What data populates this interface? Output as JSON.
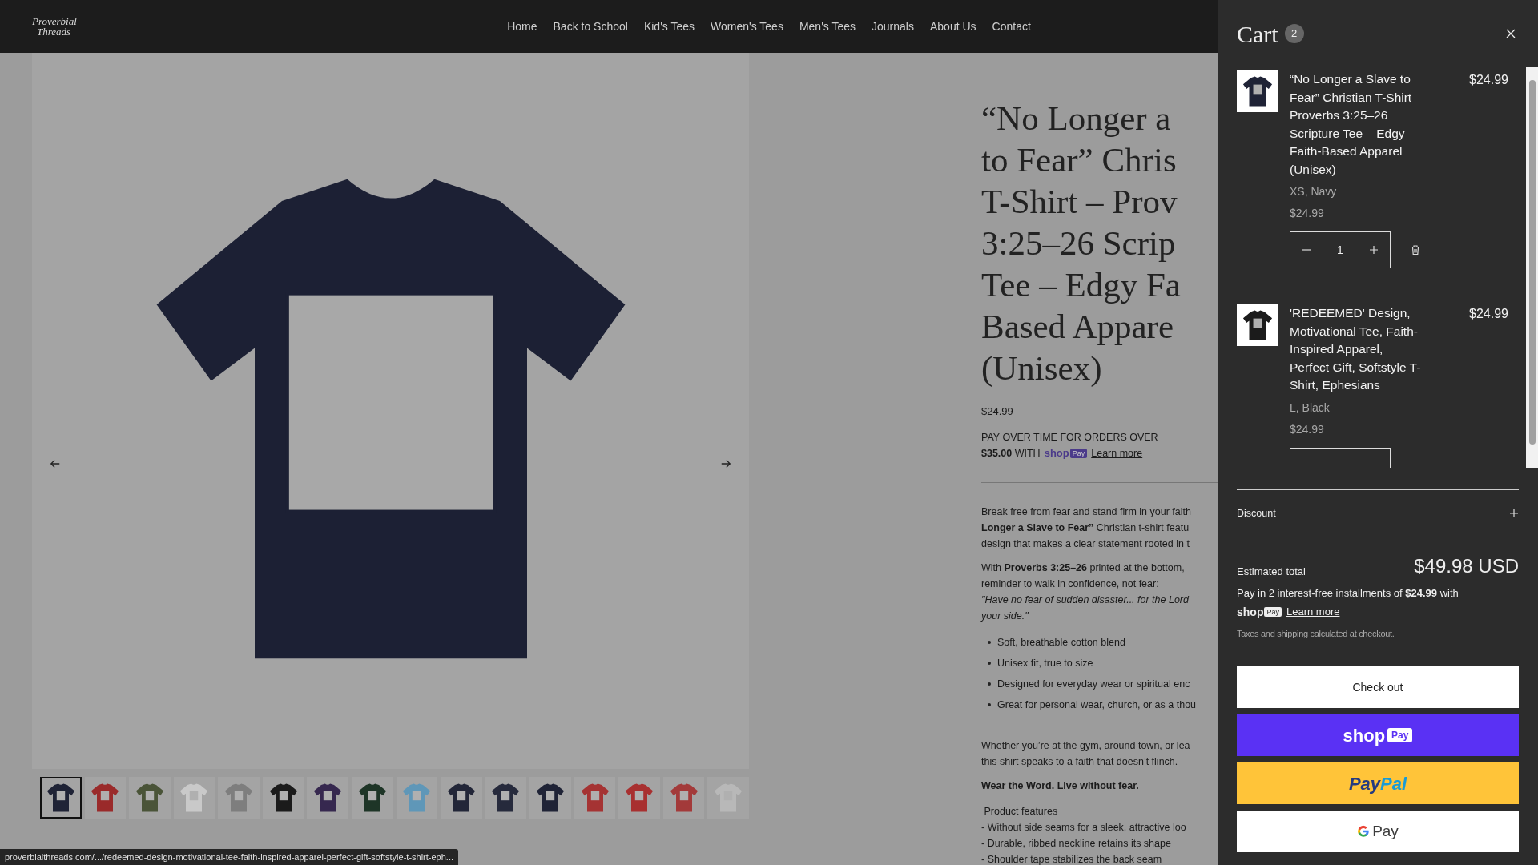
{
  "header": {
    "logo_lines": [
      "Proverbial",
      "Threads"
    ],
    "nav": [
      {
        "label": "Home"
      },
      {
        "label": "Back to School"
      },
      {
        "label": "Kid's Tees"
      },
      {
        "label": "Women's Tees"
      },
      {
        "label": "Men's Tees"
      },
      {
        "label": "Journals"
      },
      {
        "label": "About Us"
      },
      {
        "label": "Contact"
      }
    ]
  },
  "gallery": {
    "thumbnails": [
      {
        "selected": true,
        "color": "#1f2336"
      },
      {
        "selected": false,
        "color": "#9a2a2a"
      },
      {
        "selected": false,
        "color": "#4a5438"
      },
      {
        "selected": false,
        "color": "#c9c9c9"
      },
      {
        "selected": false,
        "color": "#7e7e7e"
      },
      {
        "selected": false,
        "color": "#1b1b1b"
      },
      {
        "selected": false,
        "color": "#36284f"
      },
      {
        "selected": false,
        "color": "#1e3527"
      },
      {
        "selected": false,
        "color": "#5f97b8"
      },
      {
        "selected": false,
        "color": "#222638"
      },
      {
        "selected": false,
        "color": "#262a3c"
      },
      {
        "selected": false,
        "color": "#1f2336"
      },
      {
        "selected": false,
        "color": "#a53333"
      },
      {
        "selected": false,
        "color": "#a83030"
      },
      {
        "selected": false,
        "color": "#a33a3a"
      },
      {
        "selected": false,
        "color": "#b8b8b8"
      }
    ]
  },
  "product": {
    "title_lines": [
      "“No Longer a",
      "to Fear” Chris",
      "T-Shirt – Prov",
      "3:25–26 Scrip",
      "Tee – Edgy Fa",
      "Based Appare",
      "(Unisex)"
    ],
    "price": "$24.99",
    "pay_over_time": {
      "line_1": "PAY OVER TIME FOR ORDERS OVER",
      "line_2": "**$35.00** WITH",
      "brand": "shop",
      "brand_badge": "Pay",
      "link": "Learn more"
    },
    "description": [
      {
        "kind": "paragraph",
        "lines": [
          "Break free from fear and stand firm in your faith",
          "**Longer a Slave to Fear”** Christian t-shirt featu",
          "design that makes a clear statement rooted in t"
        ]
      },
      {
        "kind": "paragraph",
        "lines": [
          "With **Proverbs 3:25–26** printed at the bottom,",
          "reminder to walk in confidence, not fear:",
          "*\"Have no fear of sudden disaster... for the Lord*",
          "*your side.\"*"
        ]
      },
      {
        "kind": "bullets",
        "lines": [
          "Soft, breathable cotton blend",
          "Unisex fit, true to size",
          "Designed for everyday wear or spiritual enc",
          "Great for personal wear, church, or as a thou"
        ]
      },
      {
        "kind": "paragraph",
        "lines": [
          "Whether you’re at the gym, around town, or lea",
          "this shirt speaks to a faith that doesn’t flinch."
        ]
      },
      {
        "kind": "heading",
        "lines": [
          "Wear the Word. Live without fear."
        ]
      },
      {
        "kind": "paragraph",
        "lines": [
          " Product features",
          "- Without side seams for a sleek, attractive loo",
          "- Durable, ribbed neckline retains its shape",
          "- Shoulder tape stabilizes the back seam"
        ]
      }
    ]
  },
  "status_bar": "proverbialthreads.com/.../redeemed-design-motivational-tee-faith-inspired-apparel-perfect-gift-softstyle-t-shirt-eph...",
  "cart": {
    "title": "Cart",
    "count": "2",
    "items": [
      {
        "title": "“No Longer a Slave to Fear” Christian T-Shirt – Proverbs 3:25–26 Scripture Tee – Edgy Faith-Based Apparel (Unisex)",
        "variant": "XS, Navy",
        "unit_price": "$24.99",
        "price": "$24.99",
        "quantity": "1",
        "color": "#1f2336"
      },
      {
        "title": "'REDEEMED' Design, Motivational Tee, Faith-Inspired Apparel, Perfect Gift, Softstyle T-Shirt, Ephesians",
        "variant": "L, Black",
        "unit_price": "$24.99",
        "price": "$24.99",
        "color": "#1b1b1b"
      }
    ],
    "discount_label": "Discount",
    "total_label": "Estimated total",
    "total": "$49.98 USD",
    "installments": "Pay in 2 interest-free installments of **$24.99** with",
    "installments_brand": "shop",
    "installments_badge": "Pay",
    "installments_link": "Learn more",
    "taxes_note": "Taxes and shipping calculated at checkout.",
    "checkout": "Check out",
    "shop_pay": {
      "brand": "shop",
      "badge": "Pay"
    },
    "paypal": {
      "part_1": "Pay",
      "part_2": "Pal"
    },
    "gpay": "Pay"
  }
}
